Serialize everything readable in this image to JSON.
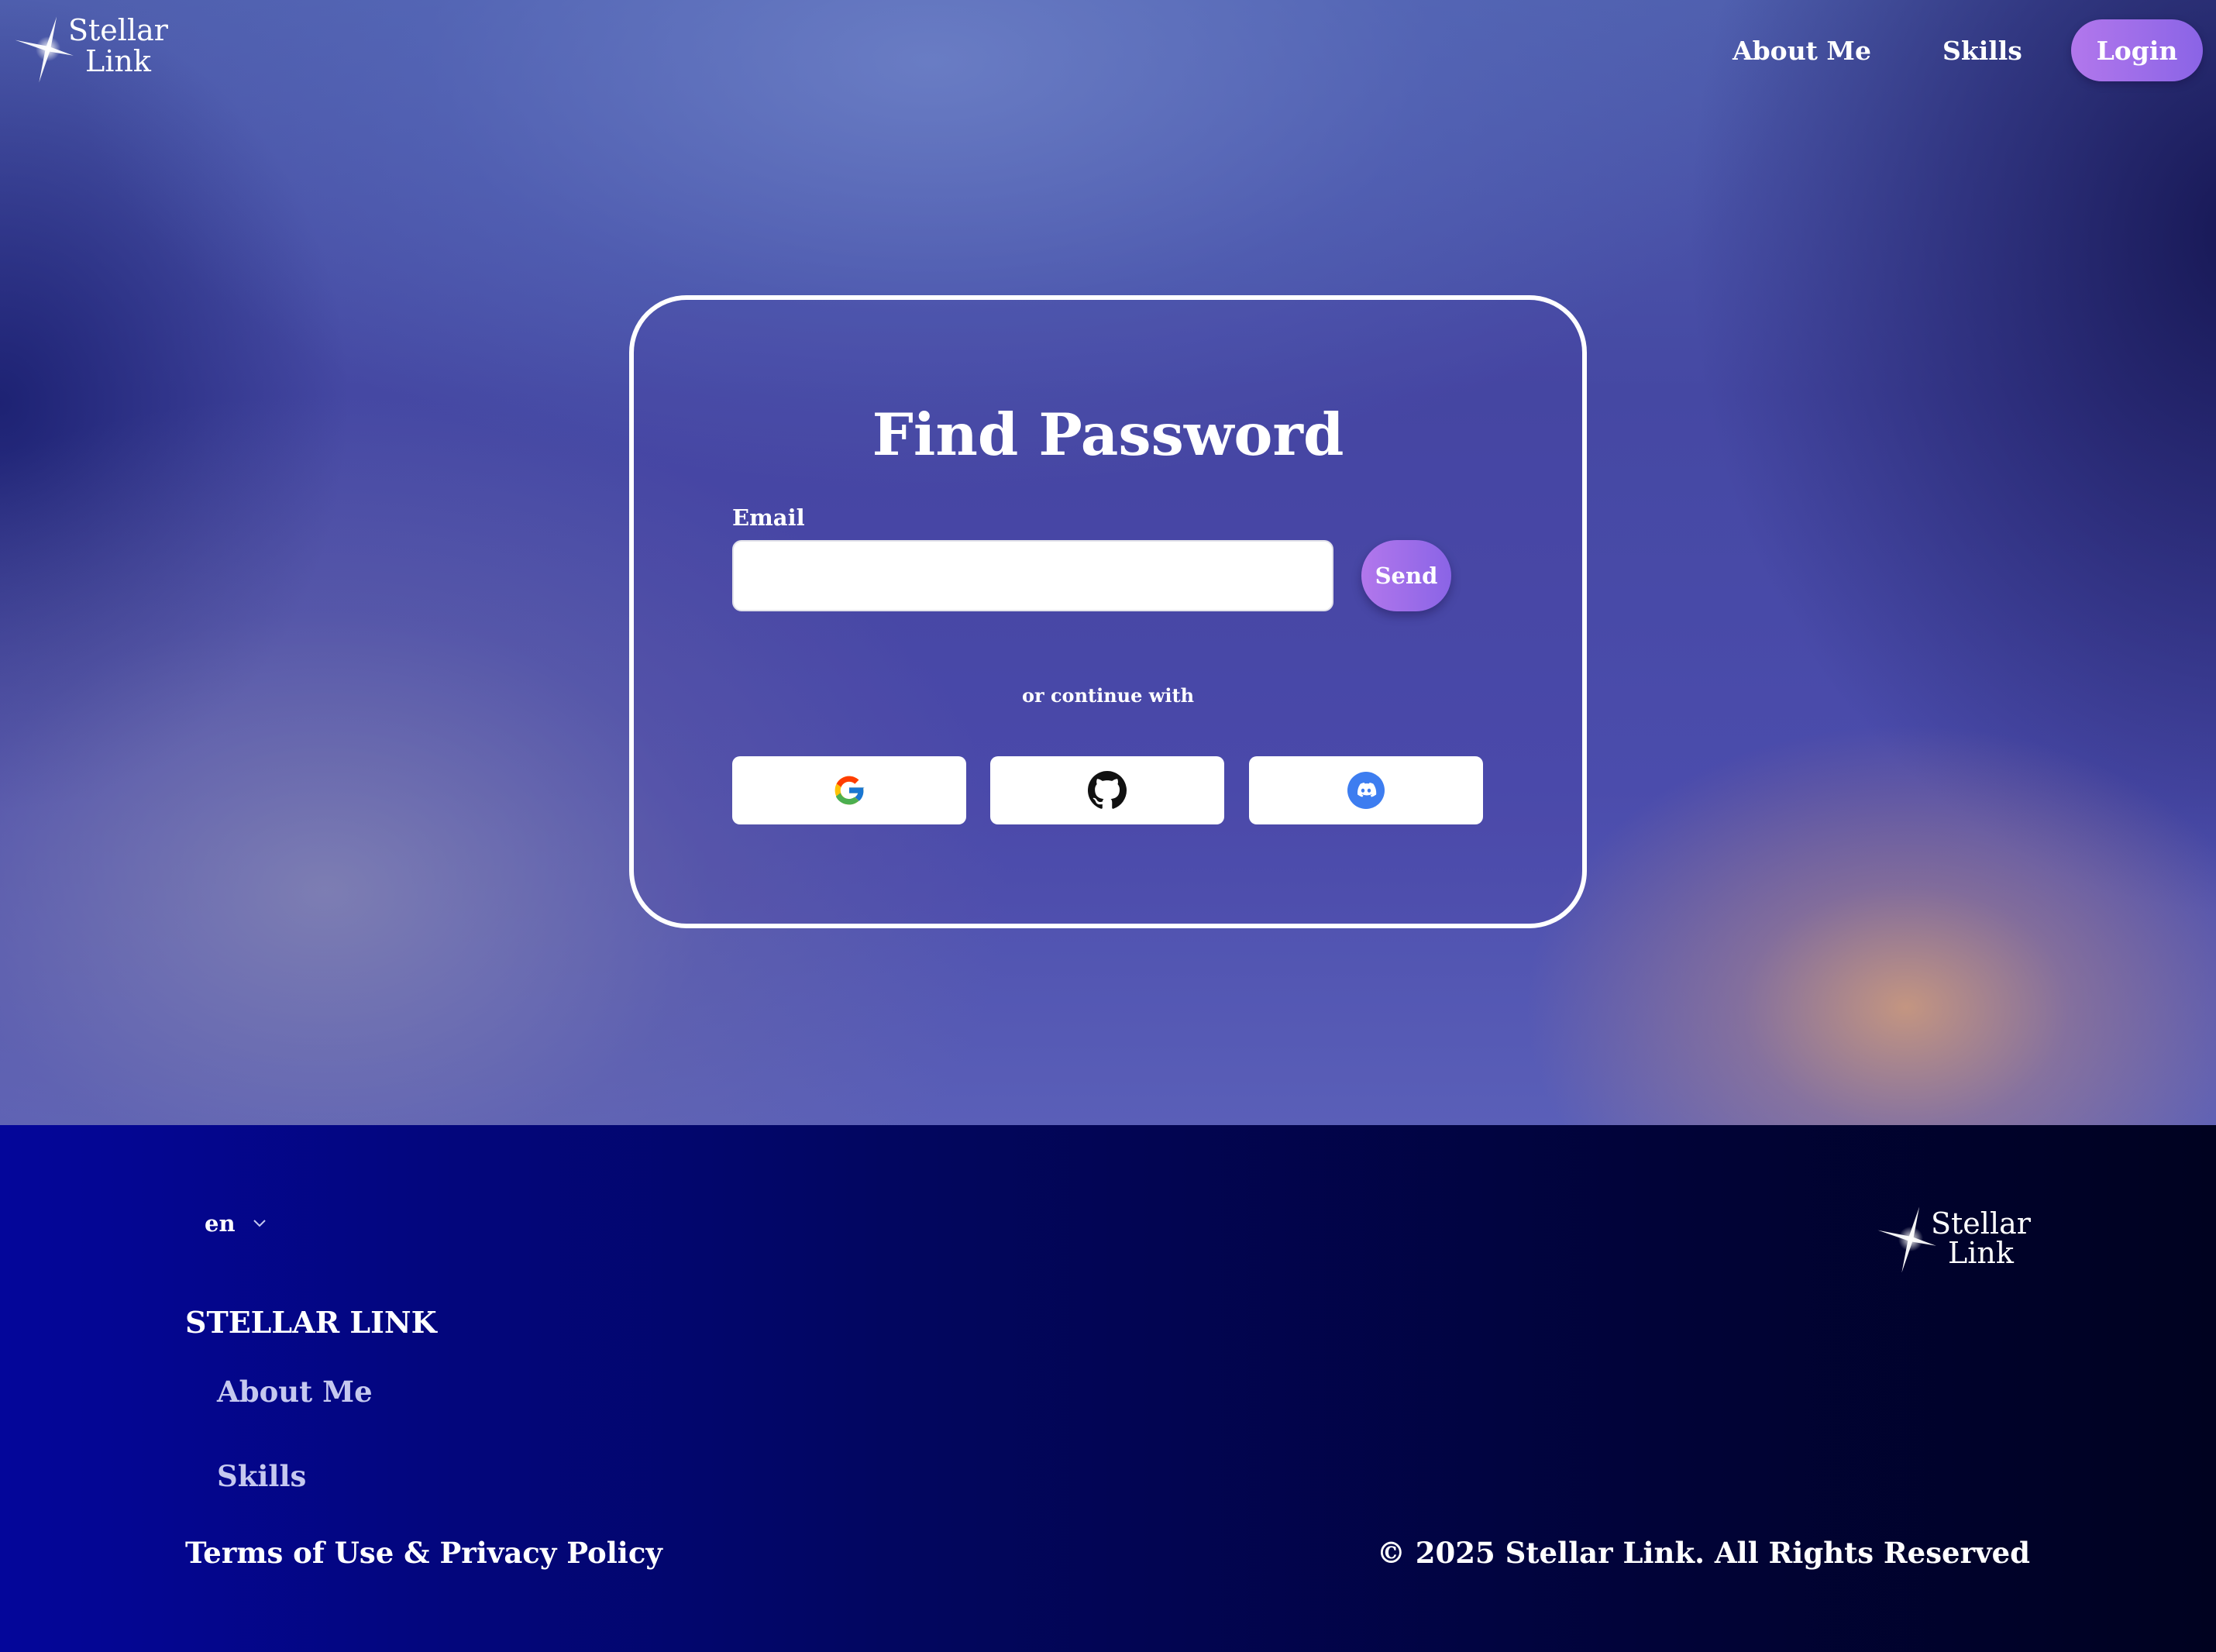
{
  "brand": {
    "line1": "Stellar",
    "line2": "Link"
  },
  "nav": {
    "about_label": "About Me",
    "skills_label": "Skills",
    "login_label": "Login"
  },
  "card": {
    "title": "Find Password",
    "email_label": "Email",
    "email_value": "",
    "email_placeholder": "",
    "send_label": "Send",
    "divider_text": "or continue with",
    "social": [
      {
        "icon": "google-icon"
      },
      {
        "icon": "github-icon"
      },
      {
        "icon": "discord-icon"
      }
    ]
  },
  "footer": {
    "language": "en",
    "brand_upper": "STELLAR LINK",
    "links": [
      "About Me",
      "Skills"
    ],
    "terms": "Terms of Use & Privacy Policy",
    "copyright": "© 2025 Stellar Link. All Rights Reserved"
  },
  "colors": {
    "accent_gradient_start": "#b277ec",
    "accent_gradient_end": "#8a64e6",
    "footer_bg": "#020660",
    "footer_link": "#c5c8ef"
  }
}
